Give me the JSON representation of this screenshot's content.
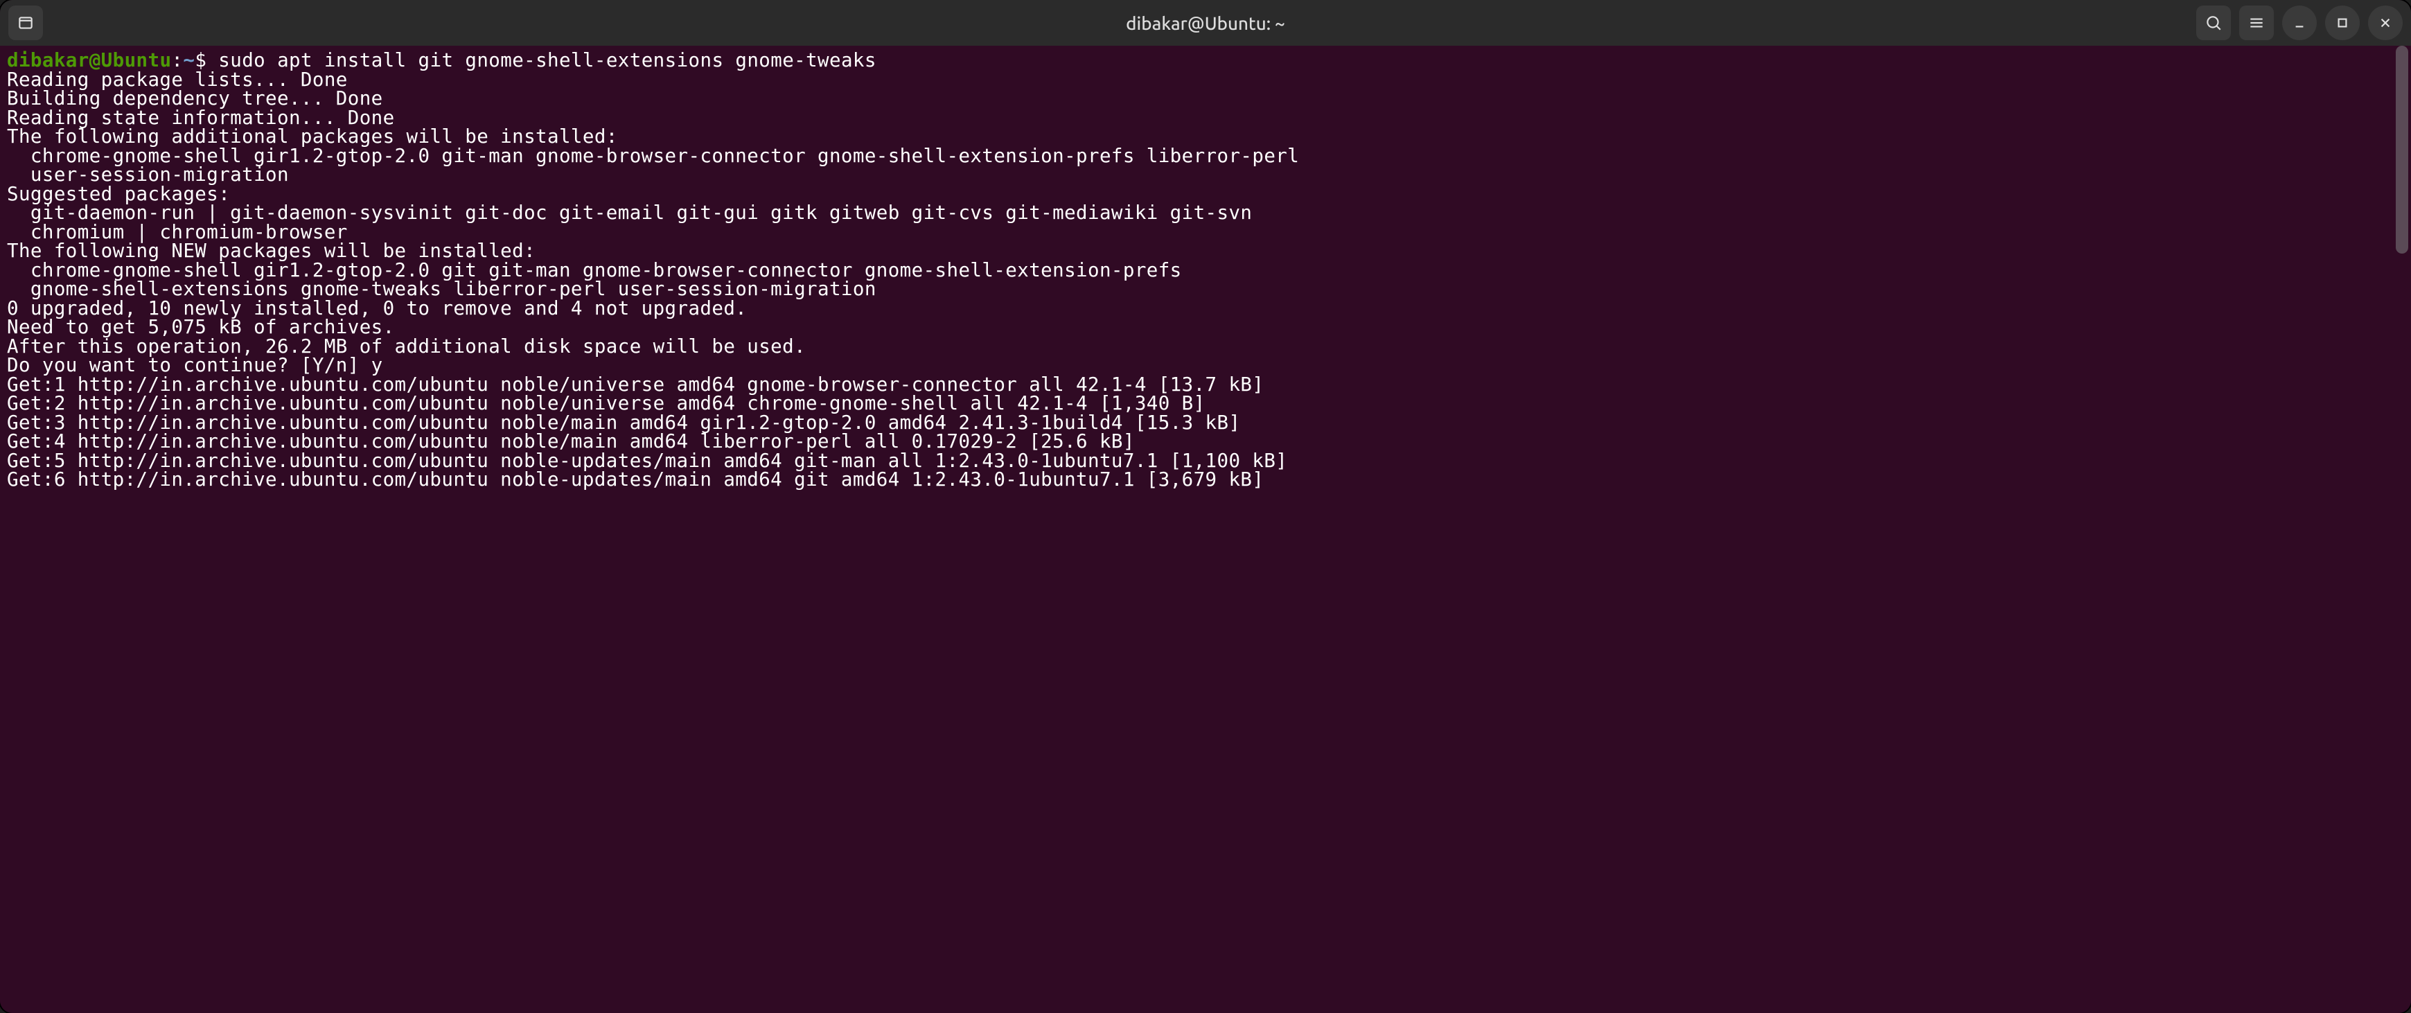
{
  "titlebar": {
    "title": "dibakar@Ubuntu: ~"
  },
  "prompt": {
    "user": "dibakar",
    "at": "@",
    "host": "Ubuntu",
    "colon": ":",
    "path": "~",
    "dollar": "$ ",
    "command": "sudo apt install git gnome-shell-extensions gnome-tweaks"
  },
  "lines": {
    "l01": "Reading package lists... Done",
    "l02": "Building dependency tree... Done",
    "l03": "Reading state information... Done",
    "l04": "The following additional packages will be installed:",
    "l05": "  chrome-gnome-shell gir1.2-gtop-2.0 git-man gnome-browser-connector gnome-shell-extension-prefs liberror-perl",
    "l06": "  user-session-migration",
    "l07": "Suggested packages:",
    "l08": "  git-daemon-run | git-daemon-sysvinit git-doc git-email git-gui gitk gitweb git-cvs git-mediawiki git-svn",
    "l09": "  chromium | chromium-browser",
    "l10": "The following NEW packages will be installed:",
    "l11": "  chrome-gnome-shell gir1.2-gtop-2.0 git git-man gnome-browser-connector gnome-shell-extension-prefs",
    "l12": "  gnome-shell-extensions gnome-tweaks liberror-perl user-session-migration",
    "l13": "0 upgraded, 10 newly installed, 0 to remove and 4 not upgraded.",
    "l14": "Need to get 5,075 kB of archives.",
    "l15": "After this operation, 26.2 MB of additional disk space will be used.",
    "l16": "Do you want to continue? [Y/n] y",
    "l17": "Get:1 http://in.archive.ubuntu.com/ubuntu noble/universe amd64 gnome-browser-connector all 42.1-4 [13.7 kB]",
    "l18": "Get:2 http://in.archive.ubuntu.com/ubuntu noble/universe amd64 chrome-gnome-shell all 42.1-4 [1,340 B]",
    "l19": "Get:3 http://in.archive.ubuntu.com/ubuntu noble/main amd64 gir1.2-gtop-2.0 amd64 2.41.3-1build4 [15.3 kB]",
    "l20": "Get:4 http://in.archive.ubuntu.com/ubuntu noble/main amd64 liberror-perl all 0.17029-2 [25.6 kB]",
    "l21": "Get:5 http://in.archive.ubuntu.com/ubuntu noble-updates/main amd64 git-man all 1:2.43.0-1ubuntu7.1 [1,100 kB]",
    "l22": "Get:6 http://in.archive.ubuntu.com/ubuntu noble-updates/main amd64 git amd64 1:2.43.0-1ubuntu7.1 [3,679 kB]"
  }
}
